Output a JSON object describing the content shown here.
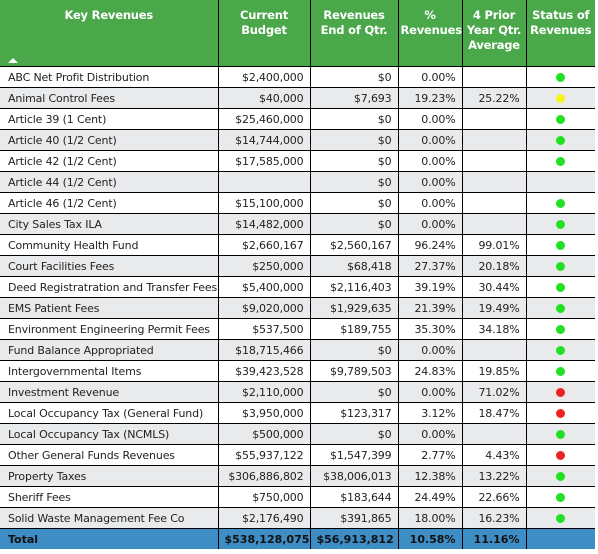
{
  "colors": {
    "header_bg": "#4aa84a",
    "total_bg": "#3e8dc5",
    "status_green": "#22e022",
    "status_yellow": "#f5f51a",
    "status_red": "#ee2222"
  },
  "header": {
    "columns": [
      {
        "label": "Key Revenues",
        "sort": "ascending"
      },
      {
        "label": "Current Budget"
      },
      {
        "label": "Revenues End of Qtr."
      },
      {
        "label": "% Revenues"
      },
      {
        "label": "4 Prior Year Qtr. Average"
      },
      {
        "label": "Status of Revenues"
      }
    ]
  },
  "rows": [
    {
      "name": "ABC Net Profit Distribution",
      "budget": "$2,400,000",
      "revenues": "$0",
      "pct": "0.00%",
      "prior": "",
      "status": "green"
    },
    {
      "name": "Animal Control Fees",
      "budget": "$40,000",
      "revenues": "$7,693",
      "pct": "19.23%",
      "prior": "25.22%",
      "status": "yellow"
    },
    {
      "name": "Article 39 (1 Cent)",
      "budget": "$25,460,000",
      "revenues": "$0",
      "pct": "0.00%",
      "prior": "",
      "status": "green"
    },
    {
      "name": "Article 40 (1/2 Cent)",
      "budget": "$14,744,000",
      "revenues": "$0",
      "pct": "0.00%",
      "prior": "",
      "status": "green"
    },
    {
      "name": "Article 42 (1/2 Cent)",
      "budget": "$17,585,000",
      "revenues": "$0",
      "pct": "0.00%",
      "prior": "",
      "status": "green"
    },
    {
      "name": "Article 44 (1/2 Cent)",
      "budget": "",
      "revenues": "$0",
      "pct": "0.00%",
      "prior": "",
      "status": ""
    },
    {
      "name": "Article 46 (1/2 Cent)",
      "budget": "$15,100,000",
      "revenues": "$0",
      "pct": "0.00%",
      "prior": "",
      "status": "green"
    },
    {
      "name": "City Sales Tax ILA",
      "budget": "$14,482,000",
      "revenues": "$0",
      "pct": "0.00%",
      "prior": "",
      "status": "green"
    },
    {
      "name": "Community Health Fund",
      "budget": "$2,660,167",
      "revenues": "$2,560,167",
      "pct": "96.24%",
      "prior": "99.01%",
      "status": "green"
    },
    {
      "name": "Court Facilities Fees",
      "budget": "$250,000",
      "revenues": "$68,418",
      "pct": "27.37%",
      "prior": "20.18%",
      "status": "green"
    },
    {
      "name": "Deed Registratration and Transfer Fees",
      "budget": "$5,400,000",
      "revenues": "$2,116,403",
      "pct": "39.19%",
      "prior": "30.44%",
      "status": "green"
    },
    {
      "name": "EMS Patient Fees",
      "budget": "$9,020,000",
      "revenues": "$1,929,635",
      "pct": "21.39%",
      "prior": "19.49%",
      "status": "green"
    },
    {
      "name": "Environment Engineering Permit Fees",
      "budget": "$537,500",
      "revenues": "$189,755",
      "pct": "35.30%",
      "prior": "34.18%",
      "status": "green"
    },
    {
      "name": "Fund Balance Appropriated",
      "budget": "$18,715,466",
      "revenues": "$0",
      "pct": "0.00%",
      "prior": "",
      "status": "green"
    },
    {
      "name": "Intergovernmental Items",
      "budget": "$39,423,528",
      "revenues": "$9,789,503",
      "pct": "24.83%",
      "prior": "19.85%",
      "status": "green"
    },
    {
      "name": "Investment Revenue",
      "budget": "$2,110,000",
      "revenues": "$0",
      "pct": "0.00%",
      "prior": "71.02%",
      "status": "red"
    },
    {
      "name": "Local Occupancy Tax (General Fund)",
      "budget": "$3,950,000",
      "revenues": "$123,317",
      "pct": "3.12%",
      "prior": "18.47%",
      "status": "red"
    },
    {
      "name": "Local Occupancy Tax (NCMLS)",
      "budget": "$500,000",
      "revenues": "$0",
      "pct": "0.00%",
      "prior": "",
      "status": "green"
    },
    {
      "name": "Other General Funds Revenues",
      "budget": "$55,937,122",
      "revenues": "$1,547,399",
      "pct": "2.77%",
      "prior": "4.43%",
      "status": "red"
    },
    {
      "name": "Property Taxes",
      "budget": "$306,886,802",
      "revenues": "$38,006,013",
      "pct": "12.38%",
      "prior": "13.22%",
      "status": "green"
    },
    {
      "name": "Sheriff Fees",
      "budget": "$750,000",
      "revenues": "$183,644",
      "pct": "24.49%",
      "prior": "22.66%",
      "status": "green"
    },
    {
      "name": "Solid Waste Management Fee Co",
      "budget": "$2,176,490",
      "revenues": "$391,865",
      "pct": "18.00%",
      "prior": "16.23%",
      "status": "green"
    }
  ],
  "total": {
    "name": "Total",
    "budget": "$538,128,075",
    "revenues": "$56,913,812",
    "pct": "10.58%",
    "prior": "11.16%",
    "status": ""
  }
}
